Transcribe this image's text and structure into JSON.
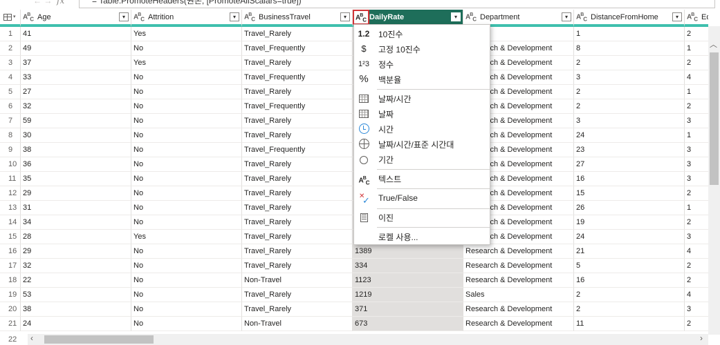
{
  "formula_bar": {
    "nav_icons": "← →",
    "fx_label": "fx",
    "text": "= Table.PromoteHeaders(원본, [PromoteAllScalars=true])"
  },
  "type_text_icon": "A B C",
  "columns": [
    {
      "name": "Age",
      "type": "ABC"
    },
    {
      "name": "Attrition",
      "type": "ABC"
    },
    {
      "name": "BusinessTravel",
      "type": "ABC"
    },
    {
      "name": "DailyRate",
      "type": "ABC"
    },
    {
      "name": "Department",
      "type": "ABC"
    },
    {
      "name": "DistanceFromHome",
      "type": "ABC"
    },
    {
      "name": "Educa",
      "type": "ABC"
    }
  ],
  "rows": [
    {
      "n": "1",
      "c": [
        "41",
        "Yes",
        "Travel_Rarely",
        "",
        "",
        "1",
        "2"
      ]
    },
    {
      "n": "2",
      "c": [
        "49",
        "No",
        "Travel_Frequently",
        "",
        "Research & Development",
        "8",
        "1"
      ]
    },
    {
      "n": "3",
      "c": [
        "37",
        "Yes",
        "Travel_Rarely",
        "",
        "Research & Development",
        "2",
        "2"
      ]
    },
    {
      "n": "4",
      "c": [
        "33",
        "No",
        "Travel_Frequently",
        "",
        "Research & Development",
        "3",
        "4"
      ]
    },
    {
      "n": "5",
      "c": [
        "27",
        "No",
        "Travel_Rarely",
        "",
        "Research & Development",
        "2",
        "1"
      ]
    },
    {
      "n": "6",
      "c": [
        "32",
        "No",
        "Travel_Frequently",
        "",
        "Research & Development",
        "2",
        "2"
      ]
    },
    {
      "n": "7",
      "c": [
        "59",
        "No",
        "Travel_Rarely",
        "",
        "Research & Development",
        "3",
        "3"
      ]
    },
    {
      "n": "8",
      "c": [
        "30",
        "No",
        "Travel_Rarely",
        "",
        "Research & Development",
        "24",
        "1"
      ]
    },
    {
      "n": "9",
      "c": [
        "38",
        "No",
        "Travel_Frequently",
        "",
        "Research & Development",
        "23",
        "3"
      ]
    },
    {
      "n": "10",
      "c": [
        "36",
        "No",
        "Travel_Rarely",
        "",
        "Research & Development",
        "27",
        "3"
      ]
    },
    {
      "n": "11",
      "c": [
        "35",
        "No",
        "Travel_Rarely",
        "",
        "Research & Development",
        "16",
        "3"
      ]
    },
    {
      "n": "12",
      "c": [
        "29",
        "No",
        "Travel_Rarely",
        "",
        "Research & Development",
        "15",
        "2"
      ]
    },
    {
      "n": "13",
      "c": [
        "31",
        "No",
        "Travel_Rarely",
        "",
        "Research & Development",
        "26",
        "1"
      ]
    },
    {
      "n": "14",
      "c": [
        "34",
        "No",
        "Travel_Rarely",
        "",
        "Research & Development",
        "19",
        "2"
      ]
    },
    {
      "n": "15",
      "c": [
        "28",
        "Yes",
        "Travel_Rarely",
        "",
        "Research & Development",
        "24",
        "3"
      ]
    },
    {
      "n": "16",
      "c": [
        "29",
        "No",
        "Travel_Rarely",
        "1389",
        "Research & Development",
        "21",
        "4"
      ]
    },
    {
      "n": "17",
      "c": [
        "32",
        "No",
        "Travel_Rarely",
        "334",
        "Research & Development",
        "5",
        "2"
      ]
    },
    {
      "n": "18",
      "c": [
        "22",
        "No",
        "Non-Travel",
        "1123",
        "Research & Development",
        "16",
        "2"
      ]
    },
    {
      "n": "19",
      "c": [
        "53",
        "No",
        "Travel_Rarely",
        "1219",
        "Sales",
        "2",
        "4"
      ]
    },
    {
      "n": "20",
      "c": [
        "38",
        "No",
        "Travel_Rarely",
        "371",
        "Research & Development",
        "2",
        "3"
      ]
    },
    {
      "n": "21",
      "c": [
        "24",
        "No",
        "Non-Travel",
        "673",
        "Research & Development",
        "11",
        "2"
      ]
    }
  ],
  "last_row_number": "22",
  "type_menu": {
    "items": [
      {
        "icon": "1.2",
        "icon_name": "decimal-number-icon",
        "label": "10진수"
      },
      {
        "icon": "$",
        "icon_name": "currency-icon",
        "label": "고정 10진수"
      },
      {
        "icon": "1²3",
        "icon_name": "whole-number-icon",
        "label": "정수"
      },
      {
        "icon": "%",
        "icon_name": "percentage-icon",
        "label": "백분율"
      },
      {
        "icon": "",
        "icon_name": "datetime-icon",
        "label": "날짜/시간"
      },
      {
        "icon": "",
        "icon_name": "date-icon",
        "label": "날짜"
      },
      {
        "icon": "",
        "icon_name": "time-icon",
        "label": "시간"
      },
      {
        "icon": "",
        "icon_name": "datetime-timezone-icon",
        "label": "날짜/시간/표준 시간대"
      },
      {
        "icon": "",
        "icon_name": "duration-icon",
        "label": "기간"
      },
      {
        "icon": "ABC",
        "icon_name": "text-icon",
        "label": "텍스트"
      },
      {
        "icon": "✓",
        "icon_name": "true-false-icon",
        "label": "True/False"
      },
      {
        "icon": "",
        "icon_name": "binary-icon",
        "label": "이진"
      },
      {
        "icon": "",
        "icon_name": "locale-icon",
        "label": "로켈 사용..."
      }
    ]
  },
  "colors": {
    "header_underline": "#3fbfad",
    "selected_header": "#1e6e5a",
    "selected_column": "#e1dfdd",
    "highlight_border": "#d13438"
  }
}
